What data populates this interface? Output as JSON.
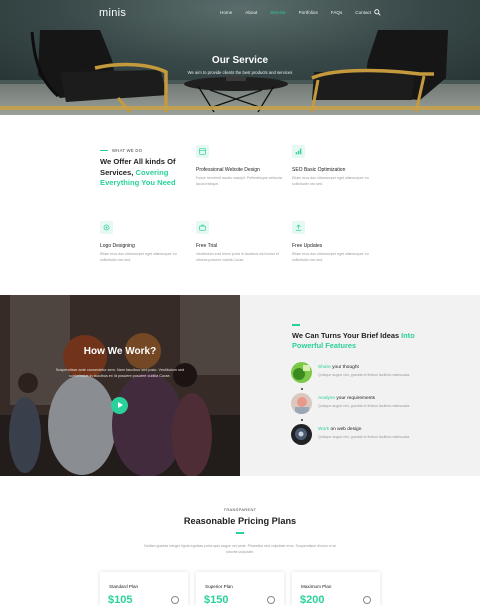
{
  "colors": {
    "accent": "#2bd19a",
    "heading": "#222222",
    "muted": "#9a9a9a",
    "panel": "#f2f2f2"
  },
  "nav": {
    "brand": "minis",
    "items": [
      {
        "label": "Home",
        "active": false
      },
      {
        "label": "About",
        "active": false
      },
      {
        "label": "Service",
        "active": true
      },
      {
        "label": "Portfolios",
        "active": false
      },
      {
        "label": "FAQs",
        "active": false
      },
      {
        "label": "Contact",
        "active": false
      }
    ],
    "search_icon": "search-icon"
  },
  "hero": {
    "title": "Our Service",
    "subtitle": "We aim to provide clients the best products and services"
  },
  "services": {
    "kicker": "WHAT WE DO",
    "heading_part1": "We Offer All kinds Of Services, ",
    "heading_highlight": "Covering Everything You Need",
    "items": [
      {
        "icon": "browser-icon",
        "title": "Professional Website Design",
        "desc": "Fusce hendrerit iaculis suscipit. Pellentesque vehicula lacus tristique."
      },
      {
        "icon": "chart-icon",
        "title": "SEO Basic Optimization",
        "desc": "Etiam eros dou ullamcorper eget ullamcorper eu sollicitudin nec sed."
      },
      {
        "icon": "settings-icon",
        "title": "Logo Designing",
        "desc": "Etiam eros dou ullamcorper eget ullamcorper eu sollicitudin nec sed."
      },
      {
        "icon": "briefcase-icon",
        "title": "Free Trial",
        "desc": "Vestibulum erat lorem porta in faucibus nisi luctus et ultrices posuere cubilia Curae."
      },
      {
        "icon": "upload-icon",
        "title": "Free Updates",
        "desc": "Etiam eros dou ullamcorper eget ullamcorper eu sollicitudin nec sed."
      }
    ]
  },
  "work": {
    "title": "How We Work?",
    "desc": "Suspendisse ante consectetur sem. Nam faucibus sed justo. Vestibulum sed scelerisque in faucibus ex id posuere posuere cubilia Curae.",
    "kicker_bar": "",
    "heading_part1": "We Can Turns Your Brief Ideas ",
    "heading_highlight": "Into Powerful Features",
    "steps": [
      {
        "highlight": "Share",
        "rest": " your thought",
        "desc": "Quisque augue nisi, gravida et finibus facilisis malesuada."
      },
      {
        "highlight": "Analyze",
        "rest": " your requirements",
        "desc": "Quisque augue nisi, gravida et finibus facilisis malesuada."
      },
      {
        "highlight": "Work",
        "rest": " on web design",
        "desc": "Quisque augue nisi, gravida et finibus facilisis malesuada."
      }
    ]
  },
  "pricing": {
    "kicker": "TRANSPARENT",
    "title": "Reasonable Pricing Plans",
    "desc": "Nullam gravida integer ligula egestas porta quis augue vel pede. Phasellus sed vulputate eros. Suspendisse dictum ut at lobortis vulputate.",
    "plans": [
      {
        "name": "Standard Plan",
        "price": "$105",
        "icon": "document-icon"
      },
      {
        "name": "Superior Plan",
        "price": "$150",
        "icon": "user-icon"
      },
      {
        "name": "Maximum Plan",
        "price": "$200",
        "icon": "rocket-icon"
      }
    ]
  }
}
